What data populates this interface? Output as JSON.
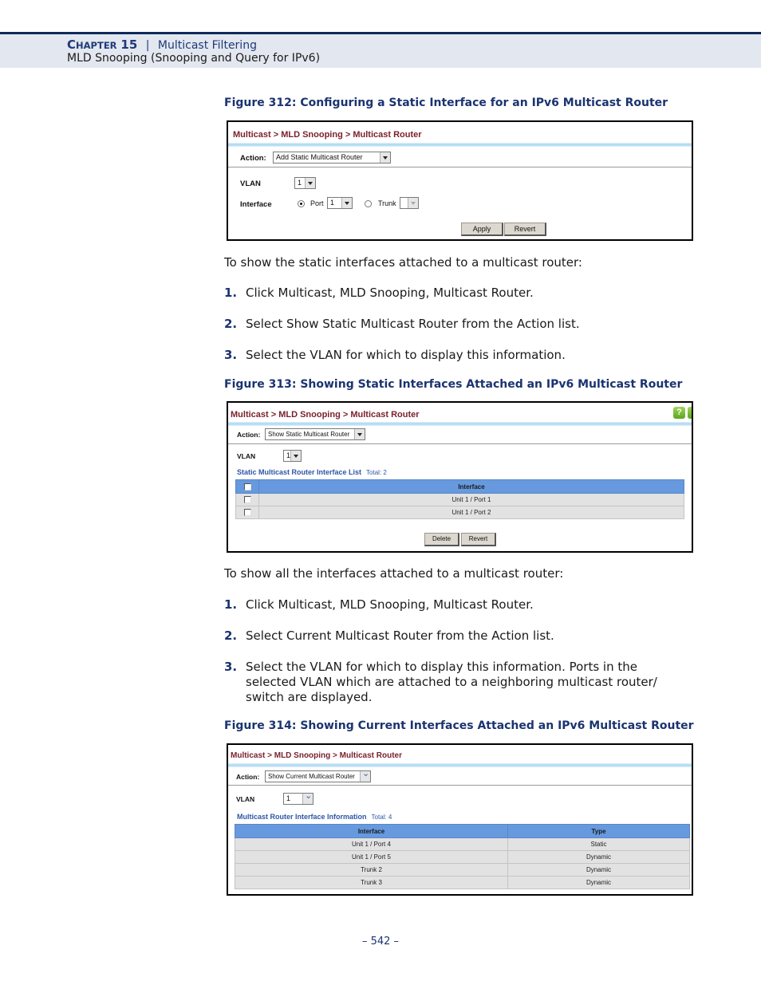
{
  "header": {
    "chapter_prefix_big": "C",
    "chapter_prefix_small": "HAPTER",
    "chapter_number": "15",
    "separator": "|",
    "chapter_title": "Multicast Filtering",
    "section_title": "MLD Snooping (Snooping and Query for IPv6)"
  },
  "figure312": {
    "caption": "Figure 312:  Configuring a Static Interface for an IPv6 Multicast Router",
    "breadcrumb": "Multicast > MLD Snooping > Multicast Router",
    "action_label": "Action:",
    "action_value": "Add Static Multicast Router",
    "vlan_label": "VLAN",
    "vlan_value": "1",
    "interface_label": "Interface",
    "port_label": "Port",
    "port_value": "1",
    "port_selected": true,
    "trunk_label": "Trunk",
    "trunk_value": "",
    "apply_label": "Apply",
    "revert_label": "Revert"
  },
  "section2": {
    "intro": "To show the static interfaces attached to a multicast router:",
    "steps": [
      {
        "num": "1.",
        "text": "Click Multicast, MLD Snooping, Multicast Router."
      },
      {
        "num": "2.",
        "text": "Select Show Static Multicast Router from the Action list."
      },
      {
        "num": "3.",
        "text": "Select the VLAN for which to display this information."
      }
    ]
  },
  "figure313": {
    "caption": "Figure 313:  Showing Static Interfaces Attached an IPv6 Multicast Router",
    "breadcrumb": "Multicast > MLD Snooping > Multicast Router",
    "help_icon": "?",
    "action_label": "Action:",
    "action_value": "Show Static Multicast Router",
    "vlan_label": "VLAN",
    "vlan_value": "1",
    "list_title": "Static Multicast Router Interface List",
    "list_total": "Total: 2",
    "table_header": "Interface",
    "rows": [
      "Unit 1 / Port 1",
      "Unit 1 / Port 2"
    ],
    "delete_label": "Delete",
    "revert_label": "Revert"
  },
  "section3": {
    "intro": "To show all the interfaces attached to a multicast router:",
    "steps": [
      {
        "num": "1.",
        "text": "Click Multicast, MLD Snooping, Multicast Router."
      },
      {
        "num": "2.",
        "text": "Select Current Multicast Router from the Action list."
      },
      {
        "num": "3.",
        "text_lines": [
          "Select the VLAN for which to display this information. Ports in the",
          "selected VLAN which are attached to a neighboring multicast router/",
          "switch are displayed."
        ]
      }
    ]
  },
  "figure314": {
    "caption": "Figure 314:  Showing Current Interfaces Attached an IPv6 Multicast Router",
    "breadcrumb": "Multicast > MLD Snooping > Multicast Router",
    "action_label": "Action:",
    "action_value": "Show Current Multicast Router",
    "vlan_label": "VLAN",
    "vlan_value": "1",
    "list_title": "Multicast Router Interface Information",
    "list_total": "Total: 4",
    "columns": [
      "Interface",
      "Type"
    ],
    "rows": [
      {
        "interface": "Unit 1 / Port 4",
        "type": "Static"
      },
      {
        "interface": "Unit 1 / Port 5",
        "type": "Dynamic"
      },
      {
        "interface": "Trunk 2",
        "type": "Dynamic"
      },
      {
        "interface": "Trunk 3",
        "type": "Dynamic"
      }
    ]
  },
  "footer": {
    "page_number": "–  542  –"
  }
}
